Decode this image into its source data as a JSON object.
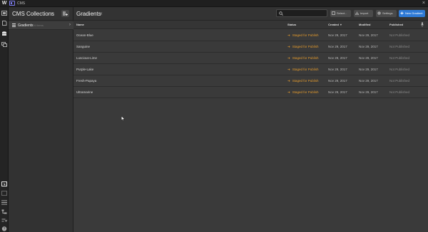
{
  "app": {
    "logo": "W",
    "title": "CMS"
  },
  "icons": {
    "rail_top": [
      "pages-icon",
      "page-icon",
      "database-icon",
      "assets-icon"
    ],
    "rail_bottom": [
      "selector-icon",
      "box-select-icon",
      "list-icon",
      "hierarchy-icon",
      "audit-icon",
      "help-icon"
    ]
  },
  "sidebar": {
    "title": "CMS Collections",
    "collections": [
      {
        "label": "Gradients",
        "count": "6 items"
      }
    ]
  },
  "main": {
    "title": "Gradients",
    "search": {
      "placeholder": "",
      "value": ""
    },
    "buttons": {
      "select": "Select...",
      "import": "Import",
      "settings": "Settings",
      "new_item": "New Gradient"
    },
    "columns": {
      "name": "Name",
      "status": "Status",
      "created": "Created",
      "modified": "Modified",
      "published": "Published"
    },
    "rows": [
      {
        "name": "Ocean-Blue",
        "status": "Staged for Publish",
        "created": "Nov 29, 2017",
        "modified": "Nov 29, 2017",
        "published": "Not Published"
      },
      {
        "name": "Sanguine",
        "status": "Staged for Publish",
        "created": "Nov 29, 2017",
        "modified": "Nov 29, 2017",
        "published": "Not Published"
      },
      {
        "name": "Luscious-Lime",
        "status": "Staged for Publish",
        "created": "Nov 29, 2017",
        "modified": "Nov 29, 2017",
        "published": "Not Published"
      },
      {
        "name": "Purple-Lake",
        "status": "Staged for Publish",
        "created": "Nov 29, 2017",
        "modified": "Nov 29, 2017",
        "published": "Not Published"
      },
      {
        "name": "Fresh-Papaya",
        "status": "Staged for Publish",
        "created": "Nov 29, 2017",
        "modified": "Nov 29, 2017",
        "published": "Not Published"
      },
      {
        "name": "Ultramarine",
        "status": "Staged for Publish",
        "created": "Nov 29, 2017",
        "modified": "Nov 29, 2017",
        "published": "Not Published"
      }
    ]
  },
  "colors": {
    "accent": "#2f7ad6",
    "staged": "#e39a2d",
    "cms": "#7d7df2",
    "background": "#3a3a3a"
  }
}
